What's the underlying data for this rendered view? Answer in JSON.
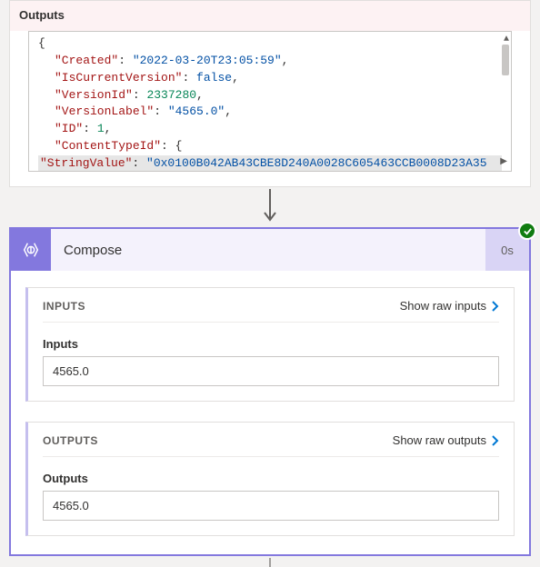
{
  "topCard": {
    "outputsLabel": "Outputs",
    "json": {
      "openBrace": "{",
      "created_key": "\"Created\"",
      "created_val": "\"2022-03-20T23:05:59\"",
      "iscurrent_key": "\"IsCurrentVersion\"",
      "iscurrent_val": "false",
      "versionid_key": "\"VersionId\"",
      "versionid_val": "2337280",
      "versionlabel_key": "\"VersionLabel\"",
      "versionlabel_val": "\"4565.0\"",
      "id_key": "\"ID\"",
      "id_val": "1",
      "contenttype_key": "\"ContentTypeId\"",
      "contenttype_colon": ": {",
      "cut_key": "\"StringValue\"",
      "cut_val": "\"0x0100B042AB43CBE8D240A0028C605463CCB0008D23A35"
    }
  },
  "compose": {
    "title": "Compose",
    "duration": "0s"
  },
  "inputs": {
    "sectionLabel": "INPUTS",
    "showRaw": "Show raw inputs",
    "fieldLabel": "Inputs",
    "value": "4565.0"
  },
  "outputs": {
    "sectionLabel": "OUTPUTS",
    "showRaw": "Show raw outputs",
    "fieldLabel": "Outputs",
    "value": "4565.0"
  }
}
